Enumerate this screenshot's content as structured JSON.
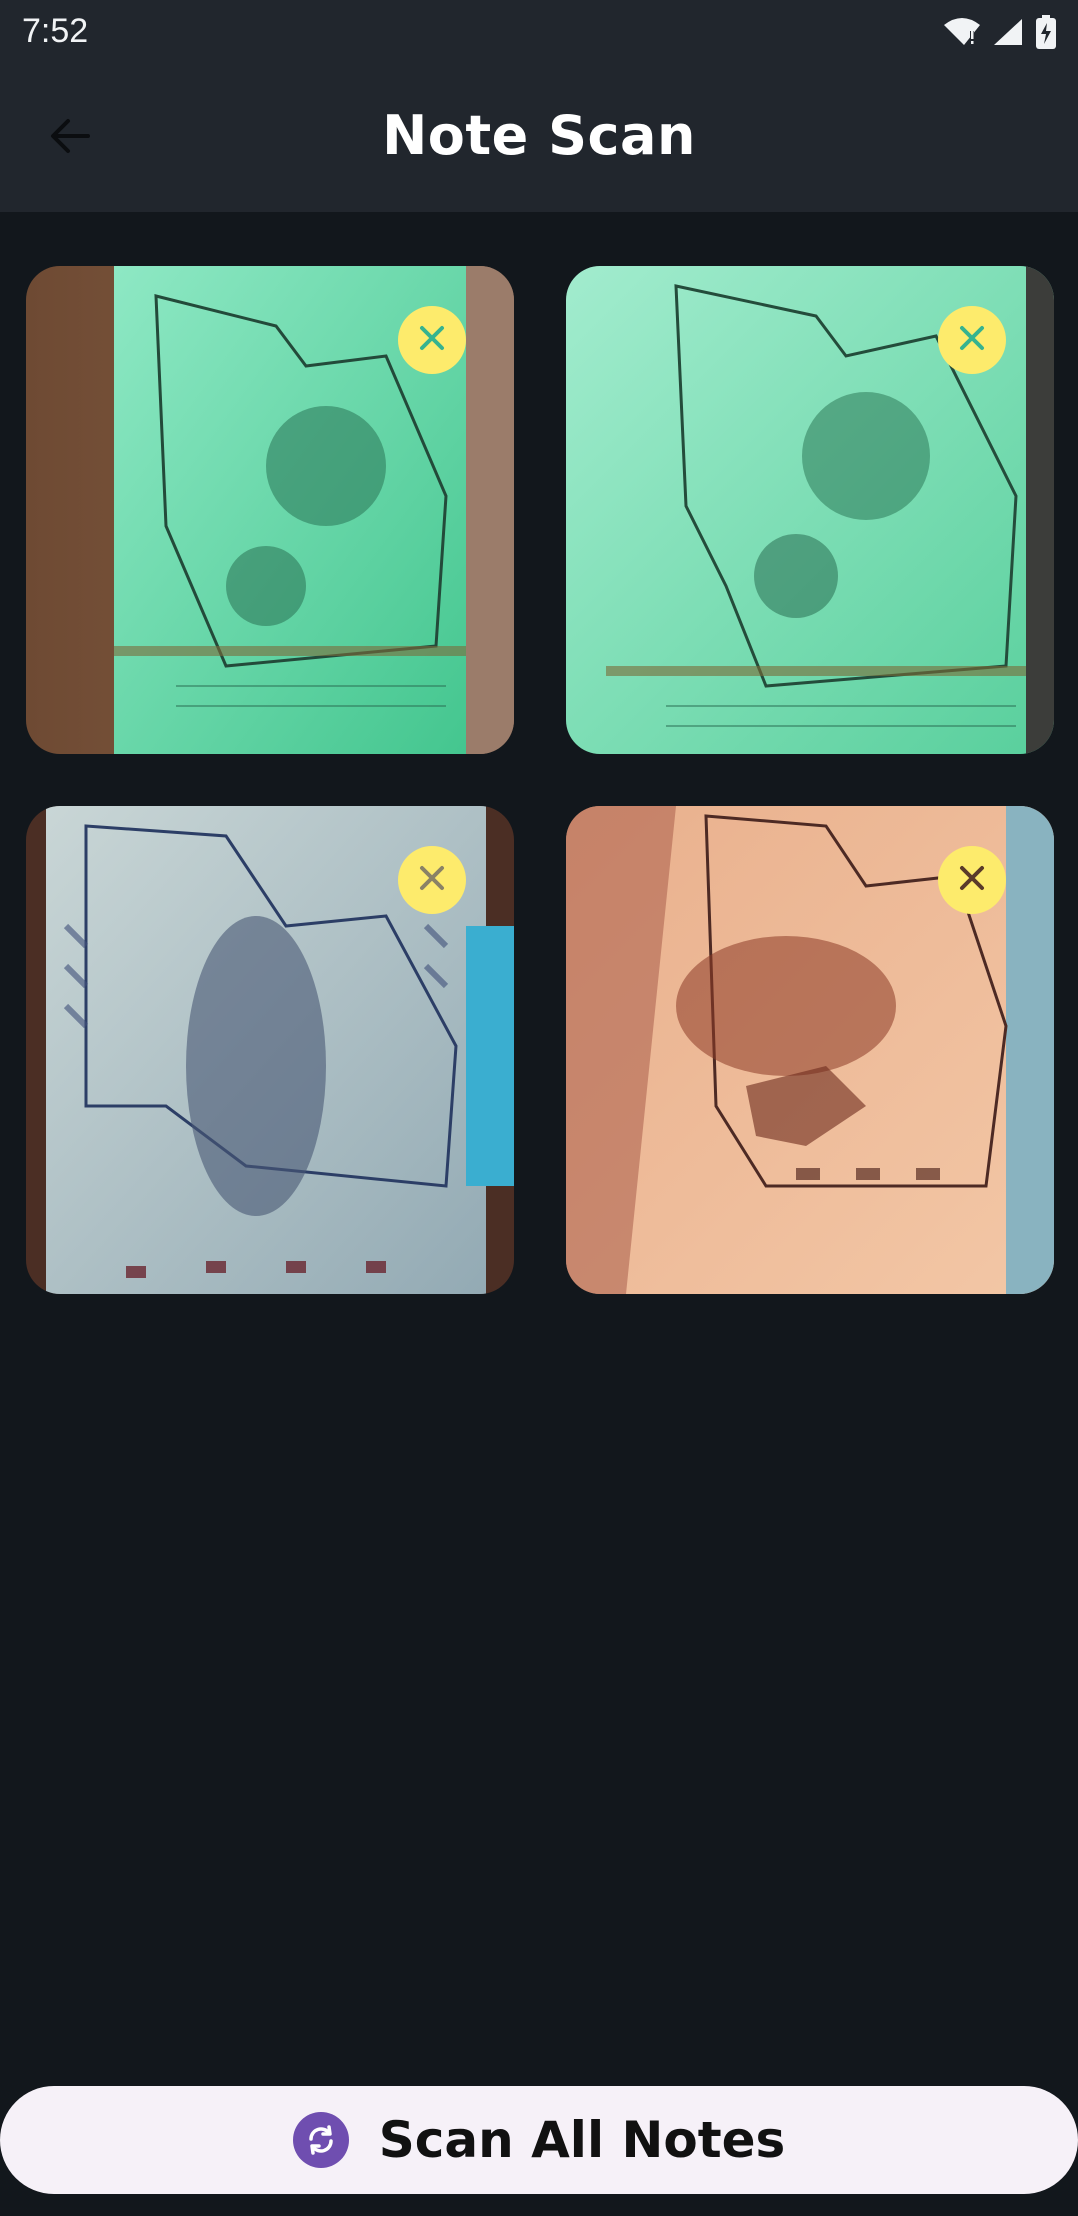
{
  "status_bar": {
    "time": "7:52",
    "icons": [
      "wifi-alert-icon",
      "cellular-signal-icon",
      "battery-charging-icon"
    ]
  },
  "app_bar": {
    "title": "Note Scan",
    "back_icon": "arrow-left-icon"
  },
  "notes": [
    {
      "remove_icon": "close-icon",
      "tint": "green"
    },
    {
      "remove_icon": "close-icon",
      "tint": "green"
    },
    {
      "remove_icon": "close-icon",
      "tint": "blue"
    },
    {
      "remove_icon": "close-icon",
      "tint": "brown"
    }
  ],
  "scan_button": {
    "label": "Scan All Notes",
    "icon": "refresh-icon"
  },
  "colors": {
    "background": "#12171c",
    "app_bar": "#21262d",
    "remove_button": "#fdeb6c",
    "scan_button_bg": "#f6f1f8",
    "scan_icon": "#6f4eb0"
  }
}
